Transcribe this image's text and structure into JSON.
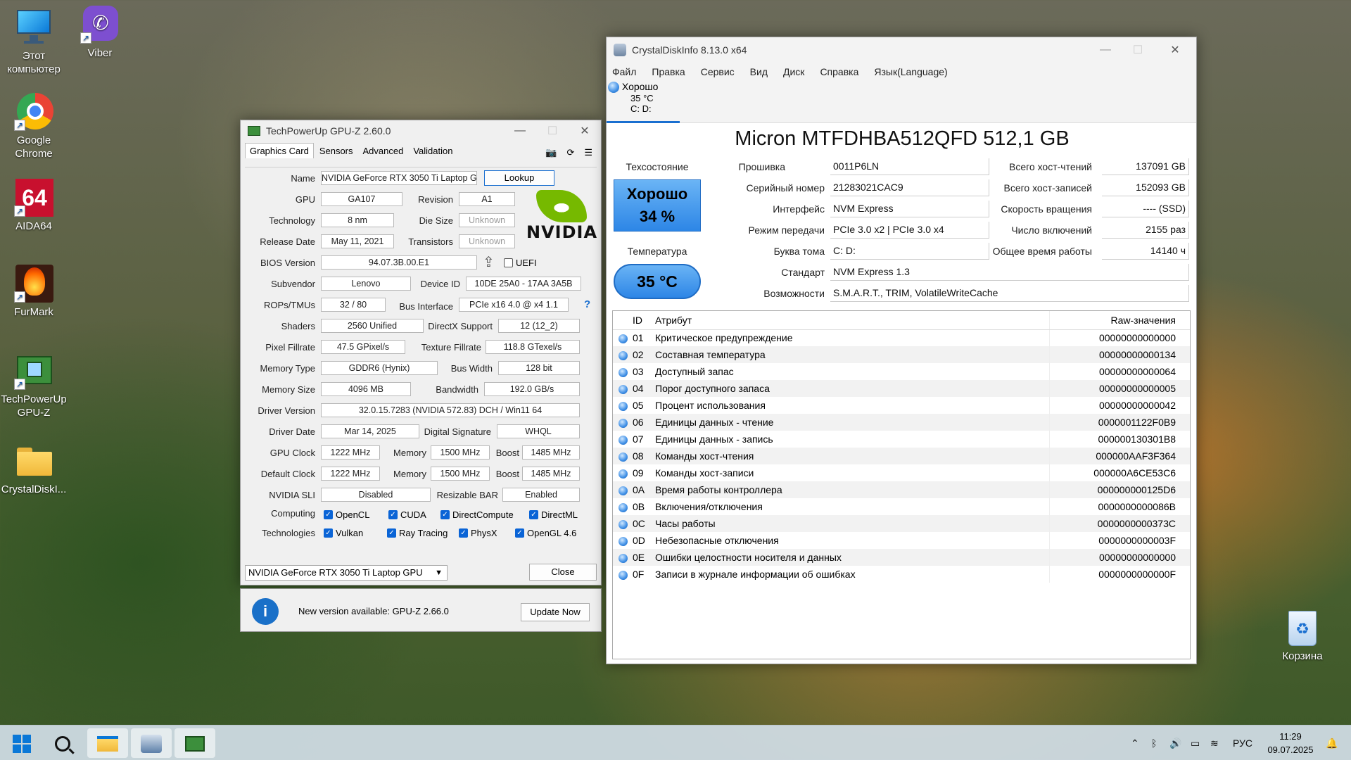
{
  "desktop": {
    "icons": [
      {
        "label": "Этот компьютер",
        "icon": "monitor-icon"
      },
      {
        "label": "Viber",
        "icon": "viber-icon"
      },
      {
        "label": "Google Chrome",
        "icon": "chrome-icon"
      },
      {
        "label": "AIDA64",
        "icon": "aida64-icon",
        "logo_text": "64"
      },
      {
        "label": "FurMark",
        "icon": "furmark-icon"
      },
      {
        "label": "TechPowerUp GPU-Z",
        "icon": "gpuz-icon"
      },
      {
        "label": "CrystalDiskI...",
        "icon": "folder-icon"
      },
      {
        "label": "Корзина",
        "icon": "recycle-bin-icon"
      }
    ]
  },
  "gpuz": {
    "title": "TechPowerUp GPU-Z 2.60.0",
    "tabs": [
      "Graphics Card",
      "Sensors",
      "Advanced",
      "Validation"
    ],
    "labels": {
      "name": "Name",
      "gpu": "GPU",
      "revision": "Revision",
      "technology": "Technology",
      "die_size": "Die Size",
      "release_date": "Release Date",
      "transistors": "Transistors",
      "bios_version": "BIOS Version",
      "uefi": "UEFI",
      "subvendor": "Subvendor",
      "device_id": "Device ID",
      "rops": "ROPs/TMUs",
      "bus_interface": "Bus Interface",
      "shaders": "Shaders",
      "directx": "DirectX Support",
      "pixel_fillrate": "Pixel Fillrate",
      "texture_fillrate": "Texture Fillrate",
      "memory_type": "Memory Type",
      "bus_width": "Bus Width",
      "memory_size": "Memory Size",
      "bandwidth": "Bandwidth",
      "driver_version": "Driver Version",
      "driver_date": "Driver Date",
      "digital_signature": "Digital Signature",
      "gpu_clock": "GPU Clock",
      "memory": "Memory",
      "boost": "Boost",
      "default_clock": "Default Clock",
      "nvidia_sli": "NVIDIA SLI",
      "resizable_bar": "Resizable BAR",
      "computing": "Computing",
      "technologies": "Technologies"
    },
    "values": {
      "name": "NVIDIA GeForce RTX 3050 Ti Laptop GPU",
      "gpu": "GA107",
      "revision": "A1",
      "technology": "8 nm",
      "die_size": "Unknown",
      "release_date": "May 11, 2021",
      "transistors": "Unknown",
      "bios_version": "94.07.3B.00.E1",
      "subvendor": "Lenovo",
      "device_id": "10DE 25A0 - 17AA 3A5B",
      "rops": "32 / 80",
      "bus_interface": "PCIe x16 4.0 @ x4 1.1",
      "shaders": "2560 Unified",
      "directx": "12 (12_2)",
      "pixel_fillrate": "47.5 GPixel/s",
      "texture_fillrate": "118.8 GTexel/s",
      "memory_type": "GDDR6 (Hynix)",
      "bus_width": "128 bit",
      "memory_size": "4096 MB",
      "bandwidth": "192.0 GB/s",
      "driver_version": "32.0.15.7283 (NVIDIA 572.83) DCH / Win11 64",
      "driver_date": "Mar 14, 2025",
      "digital_signature": "WHQL",
      "gpu_clock": "1222 MHz",
      "gpu_memory": "1500 MHz",
      "gpu_boost": "1485 MHz",
      "default_clock": "1222 MHz",
      "default_memory": "1500 MHz",
      "default_boost": "1485 MHz",
      "nvidia_sli": "Disabled",
      "resizable_bar": "Enabled"
    },
    "computing": [
      "OpenCL",
      "CUDA",
      "DirectCompute",
      "DirectML"
    ],
    "technologies": [
      "Vulkan",
      "Ray Tracing",
      "PhysX",
      "OpenGL 4.6"
    ],
    "lookup_label": "Lookup",
    "help_glyph": "?",
    "vendor_logo": "NVIDIA",
    "selected_gpu": "NVIDIA GeForce RTX 3050 Ti Laptop GPU",
    "close_label": "Close",
    "update_message": "New version available: GPU-Z 2.66.0",
    "update_label": "Update Now"
  },
  "cdi": {
    "title": "CrystalDiskInfo 8.13.0 x64",
    "menu": [
      "Файл",
      "Правка",
      "Сервис",
      "Вид",
      "Диск",
      "Справка",
      "Язык(Language)"
    ],
    "disk_tab": {
      "status": "Хорошо",
      "temp": "35 °C",
      "letters": "C: D:"
    },
    "model": "Micron MTFDHBA512QFD 512,1 GB",
    "health_label": "Техсостояние",
    "health_status": "Хорошо",
    "health_percent": "34 %",
    "temp_label": "Температура",
    "temp_value": "35 °C",
    "fields": {
      "firmware_label": "Прошивка",
      "firmware": "0011P6LN",
      "serial_label": "Серийный номер",
      "serial": "21283021CAC9",
      "interface_label": "Интерфейс",
      "interface": "NVM Express",
      "transfer_label": "Режим передачи",
      "transfer": "PCIe 3.0 x2 | PCIe 3.0 x4",
      "letter_label": "Буква тома",
      "letter": "C: D:",
      "standard_label": "Стандарт",
      "standard": "NVM Express 1.3",
      "features_label": "Возможности",
      "features": "S.M.A.R.T., TRIM, VolatileWriteCache",
      "host_reads_label": "Всего хост-чтений",
      "host_reads": "137091 GB",
      "host_writes_label": "Всего хост-записей",
      "host_writes": "152093 GB",
      "rotation_label": "Скорость вращения",
      "rotation": "---- (SSD)",
      "power_on_count_label": "Число включений",
      "power_on_count": "2155 раз",
      "power_on_hours_label": "Общее время работы",
      "power_on_hours": "14140 ч"
    },
    "smart_headers": {
      "id": "ID",
      "attr": "Атрибут",
      "raw": "Raw-значения"
    },
    "smart_rows": [
      {
        "id": "01",
        "attr": "Критическое предупреждение",
        "raw": "00000000000000"
      },
      {
        "id": "02",
        "attr": "Составная температура",
        "raw": "00000000000134"
      },
      {
        "id": "03",
        "attr": "Доступный запас",
        "raw": "00000000000064"
      },
      {
        "id": "04",
        "attr": "Порог доступного запаса",
        "raw": "00000000000005"
      },
      {
        "id": "05",
        "attr": "Процент использования",
        "raw": "00000000000042"
      },
      {
        "id": "06",
        "attr": "Единицы данных - чтение",
        "raw": "0000001122F0B9"
      },
      {
        "id": "07",
        "attr": "Единицы данных - запись",
        "raw": "000000130301B8"
      },
      {
        "id": "08",
        "attr": "Команды хост-чтения",
        "raw": "000000AAF3F364"
      },
      {
        "id": "09",
        "attr": "Команды хост-записи",
        "raw": "000000A6CE53C6"
      },
      {
        "id": "0A",
        "attr": "Время работы контроллера",
        "raw": "000000000125D6"
      },
      {
        "id": "0B",
        "attr": "Включения/отключения",
        "raw": "0000000000086B"
      },
      {
        "id": "0C",
        "attr": "Часы работы",
        "raw": "0000000000373C"
      },
      {
        "id": "0D",
        "attr": "Небезопасные отключения",
        "raw": "0000000000003F"
      },
      {
        "id": "0E",
        "attr": "Ошибки целостности носителя и данных",
        "raw": "00000000000000"
      },
      {
        "id": "0F",
        "attr": "Записи в журнале информации об ошибках",
        "raw": "0000000000000F"
      }
    ],
    "accent": "#2d86e6"
  },
  "taskbar": {
    "apps": [
      "start-icon",
      "search-icon",
      "file-explorer-icon",
      "crystaldiskinfo-icon",
      "gpuz-icon"
    ],
    "tray_lang": "РУС",
    "time": "11:29",
    "date": "09.07.2025"
  }
}
